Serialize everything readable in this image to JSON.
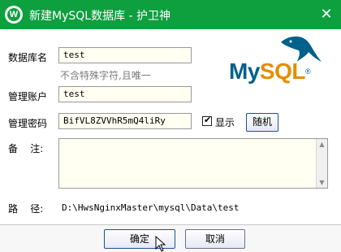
{
  "window": {
    "title": "新建MySQL数据库 - 护卫神",
    "logo_letter": "W",
    "close_glyph": "✕"
  },
  "form": {
    "db_name_label": "数据库名",
    "db_name_value": "test",
    "db_name_hint": "不含特殊字符,且唯一",
    "account_label": "管理账户",
    "account_value": "test",
    "password_label": "管理密码",
    "password_value": "BifVL8ZVVhR5mQ4liRy",
    "show_label": "显示",
    "show_checked": true,
    "random_button": "随机",
    "note_label": "备    注:",
    "note_value": "",
    "path_label": "路    径:",
    "path_value": "D:\\HwsNginxMaster\\mysql\\Data\\test"
  },
  "buttons": {
    "ok": "确定",
    "cancel": "取消"
  },
  "brand": {
    "logo_text_my": "My",
    "logo_text_sql": "SQL",
    "trademark": "®"
  },
  "colors": {
    "titlebar": "#0e9f3f",
    "mysql_blue": "#00618a",
    "mysql_orange": "#e48e00"
  }
}
